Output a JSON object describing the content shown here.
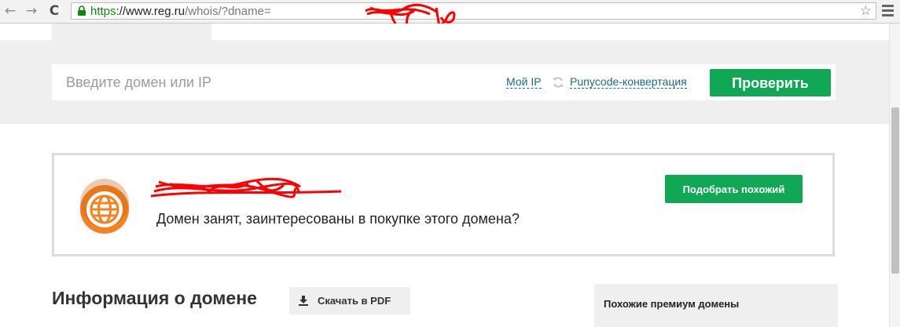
{
  "browser": {
    "url_scheme": "https",
    "url_host": "://www.reg.ru",
    "url_path": "/whois/?dname=",
    "icons": [
      "back-arrow-icon",
      "forward-arrow-icon",
      "reload-icon",
      "lock-icon",
      "star-icon",
      "menu-icon"
    ],
    "nav_back": "←",
    "nav_forward": "→",
    "nav_reload": "C",
    "bookmark_star": "☆"
  },
  "search": {
    "placeholder": "Введите домен или IP",
    "value": "",
    "my_ip_link": "Мой IP",
    "punycode_link": "Punycode-конвертация",
    "check_button": "Проверить"
  },
  "result": {
    "status_text": "Домен занят, заинтересованы в покупке этого домена?",
    "similar_button": "Подобрать похожий",
    "icon": "globe-icon"
  },
  "info": {
    "title": "Информация о домене",
    "download_pdf_button": "Скачать в PDF"
  },
  "premium": {
    "title": "Похожие премиум домены"
  },
  "colors": {
    "accent_green": "#10a854",
    "link_blue": "#1a6a8e",
    "globe_orange": "#f58220",
    "redaction_red": "#ff0000",
    "band_grey": "#efefef"
  }
}
